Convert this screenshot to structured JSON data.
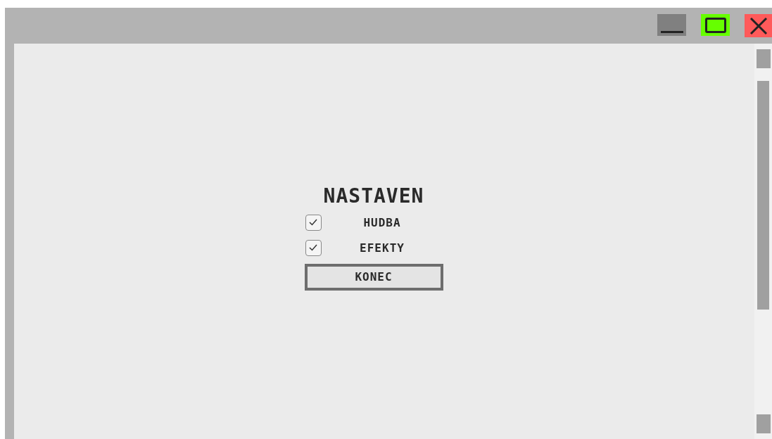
{
  "dialog": {
    "title": "NASTAVEN",
    "options": [
      {
        "label": "HUDBA",
        "checked": true
      },
      {
        "label": "EFEKTY",
        "checked": true
      }
    ],
    "button": "KONEC"
  }
}
